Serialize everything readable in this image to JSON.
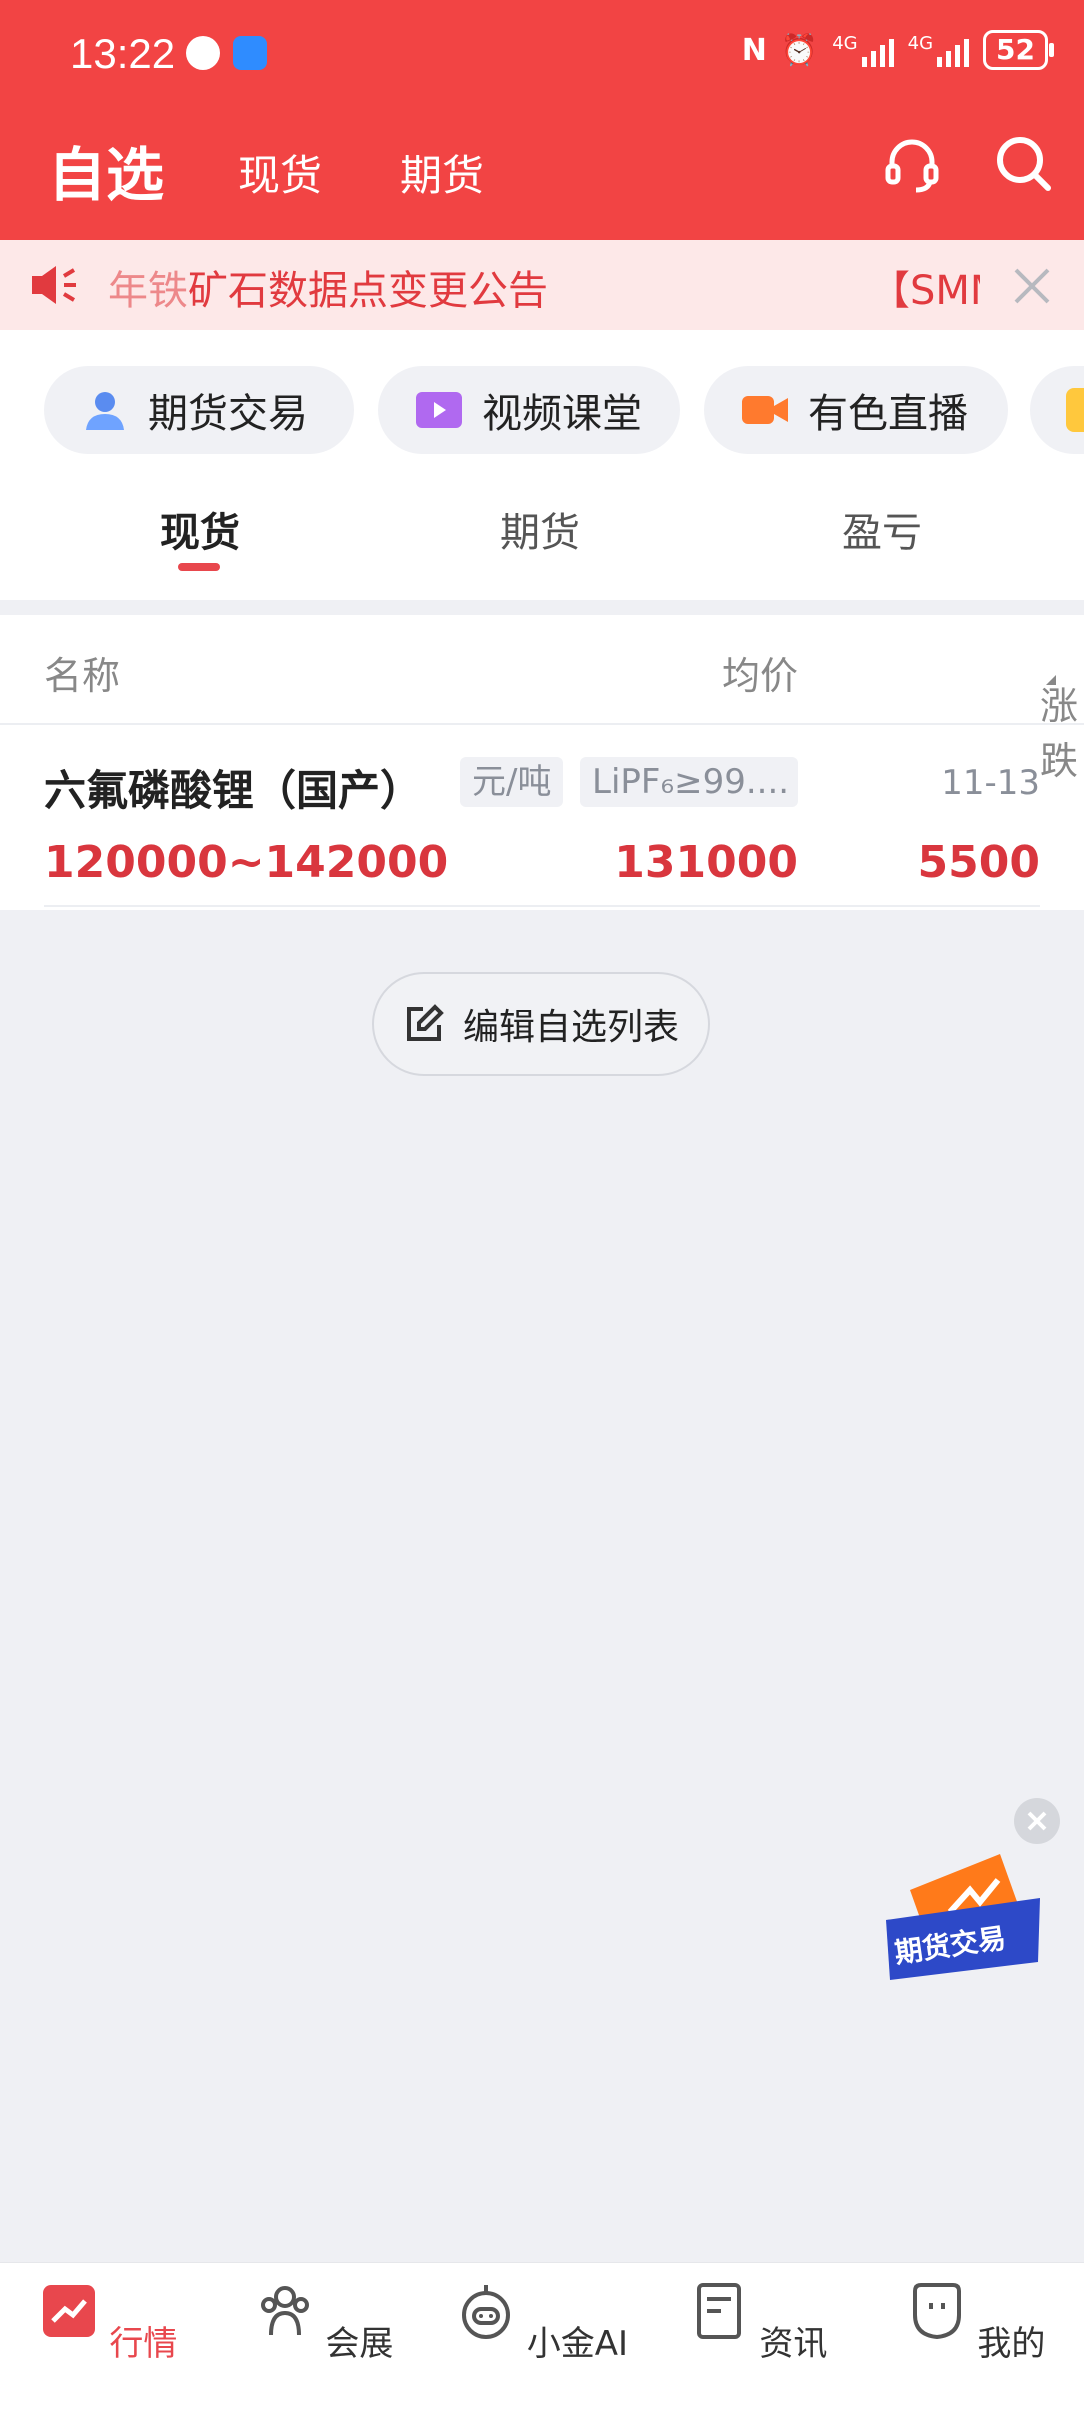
{
  "status_bar": {
    "time": "13:22",
    "battery": "52",
    "network": "4G"
  },
  "nav": {
    "title": "自选",
    "tab_spot": "现货",
    "tab_futures": "期货"
  },
  "notice": {
    "text": "矿石数据点变更公告",
    "text_truncated": "【SMM",
    "prefix": "年铁"
  },
  "chips": [
    {
      "label": "期货交易",
      "icon": "user-icon"
    },
    {
      "label": "视频课堂",
      "icon": "video-icon"
    },
    {
      "label": "有色直播",
      "icon": "camera-icon"
    }
  ],
  "tabs": [
    {
      "label": "现货",
      "active": true
    },
    {
      "label": "期货",
      "active": false
    },
    {
      "label": "盈亏",
      "active": false
    }
  ],
  "list": {
    "headers": {
      "name": "名称",
      "avg": "均价",
      "change": "涨跌"
    },
    "rows": [
      {
        "name": "六氟磷酸锂（国产）",
        "unit": "元/吨",
        "spec": "LiPF₆≥99....",
        "date": "11-13",
        "range": "120000~142000",
        "avg": "131000",
        "change": "5500"
      }
    ]
  },
  "edit_button": "编辑自选列表",
  "float_badge": "期货交易",
  "bottom_nav": [
    {
      "label": "行情",
      "icon": "chart-icon",
      "active": true
    },
    {
      "label": "会展",
      "icon": "people-icon",
      "active": false
    },
    {
      "label": "小金AI",
      "icon": "robot-icon",
      "active": false
    },
    {
      "label": "资讯",
      "icon": "document-icon",
      "active": false
    },
    {
      "label": "我的",
      "icon": "profile-icon",
      "active": false
    }
  ],
  "colors": {
    "brand_red": "#f24444",
    "price_red": "#d9363e",
    "accent": "#e8474d"
  }
}
